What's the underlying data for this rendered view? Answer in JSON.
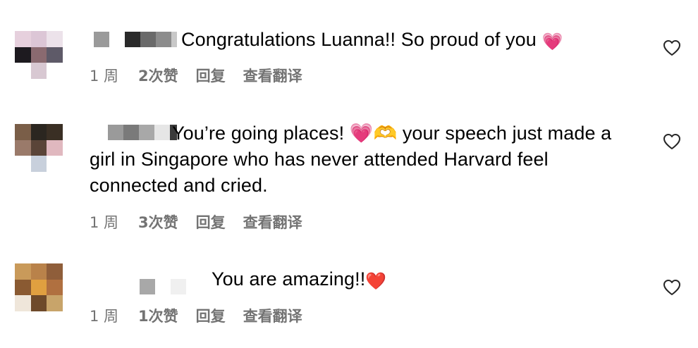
{
  "comments": [
    {
      "text": "Congratulations Luanna!! So proud of you",
      "emoji": "💗",
      "time": "1 周",
      "likes": "2次赞",
      "reply": "回复",
      "translate": "查看翻译"
    },
    {
      "lines": [
        "You’re going places! 💗🫶 your speech just made a",
        "girl in Singapore who has never attended Harvard feel",
        "connected and cried."
      ],
      "time": "1 周",
      "likes": "3次赞",
      "reply": "回复",
      "translate": "查看翻译"
    },
    {
      "text": "You are amazing!!",
      "emoji": "❤️",
      "time": "1 周",
      "likes": "1次赞",
      "reply": "回复",
      "translate": "查看翻译"
    }
  ],
  "icons": {
    "like": "heart-outline-icon"
  },
  "colors": {
    "meta_text": "#737373",
    "background": "#ffffff"
  }
}
